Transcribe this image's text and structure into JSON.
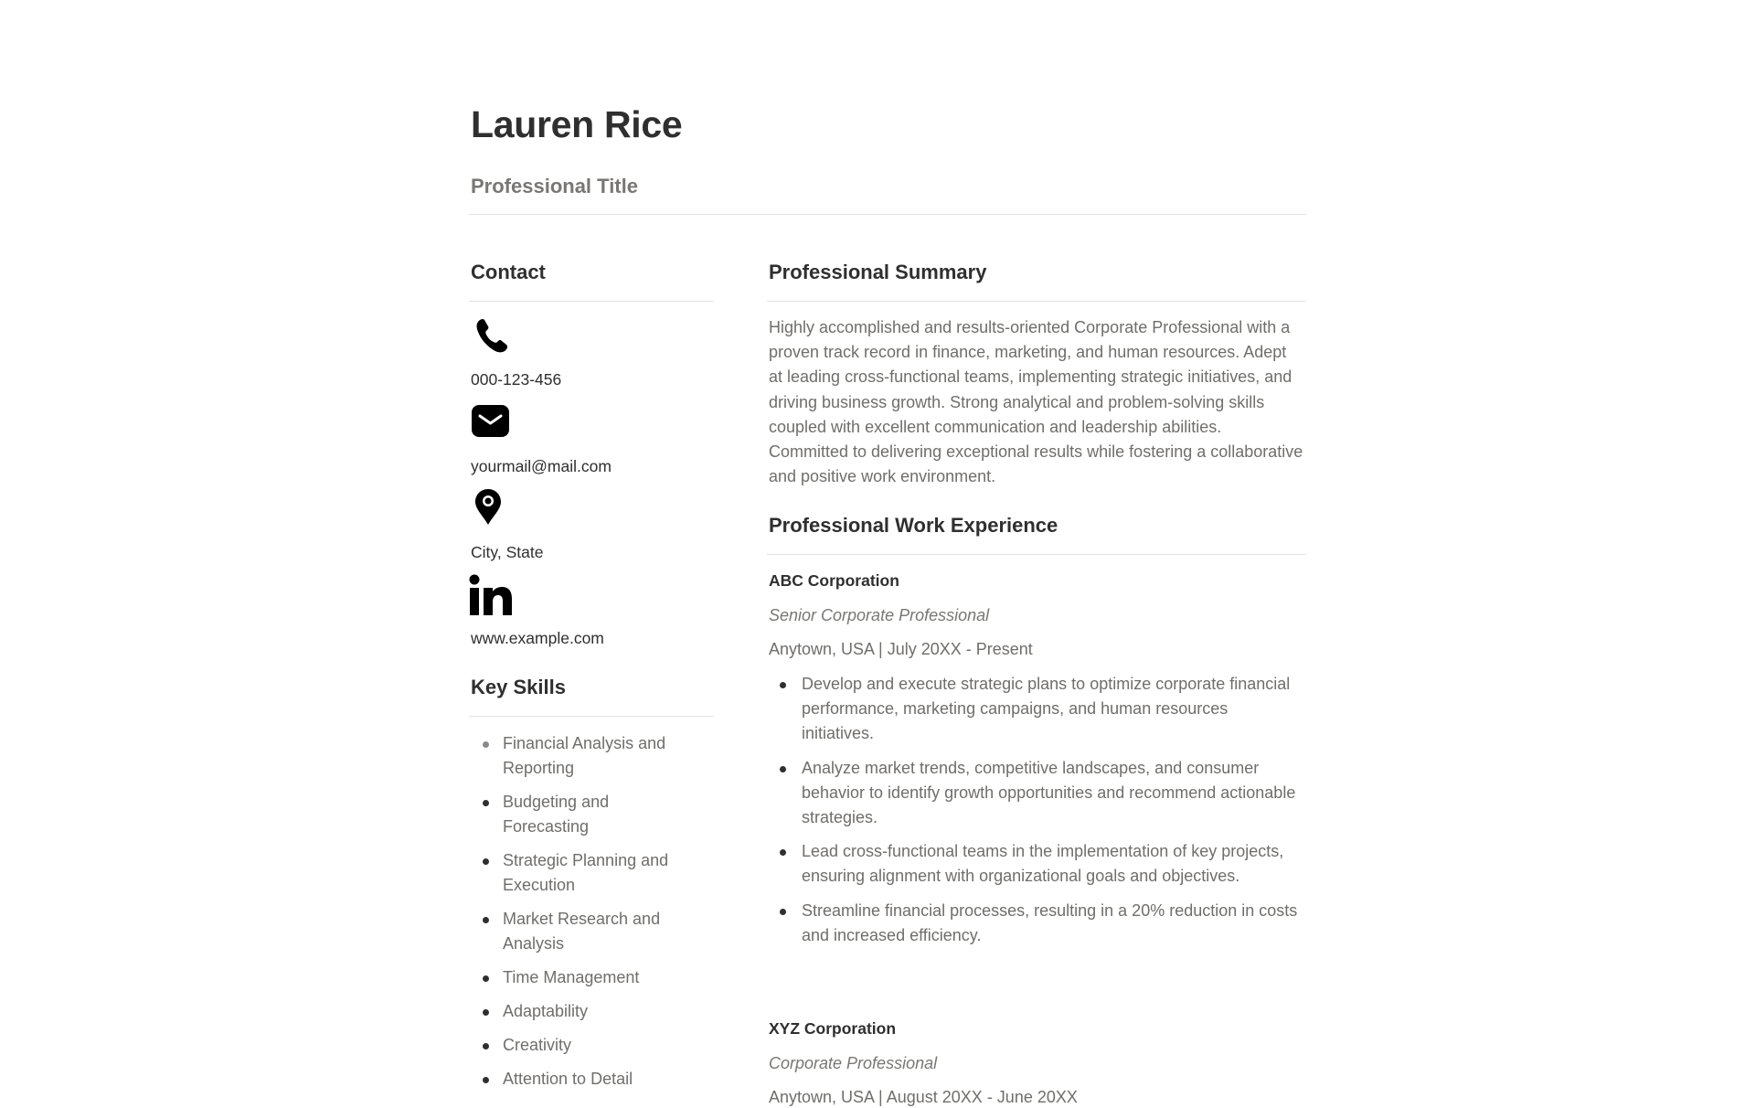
{
  "header": {
    "name": "Lauren Rice",
    "title": "Professional Title"
  },
  "contact": {
    "heading": "Contact",
    "items": [
      {
        "icon": "phone-icon",
        "value": "000-123-456"
      },
      {
        "icon": "email-icon",
        "value": "yourmail@mail.com"
      },
      {
        "icon": "location-pin-icon",
        "value": "City, State"
      },
      {
        "icon": "linkedin-icon",
        "value": "www.example.com"
      }
    ]
  },
  "skills": {
    "heading": "Key Skills",
    "items": [
      "Financial Analysis and Reporting",
      "Budgeting and Forecasting",
      "Strategic Planning and Execution",
      "Market Research and Analysis",
      "Time Management",
      "Adaptability",
      "Creativity",
      "Attention to Detail"
    ]
  },
  "summary": {
    "heading": "Professional Summary",
    "text": "Highly accomplished and results-oriented Corporate Professional with a proven track record in finance, marketing, and human resources. Adept at leading cross-functional teams, implementing strategic initiatives, and driving business growth. Strong analytical and problem-solving skills coupled with excellent communication and leadership abilities. Committed to delivering exceptional results while fostering a collaborative and positive work environment."
  },
  "experience": {
    "heading": "Professional Work Experience",
    "jobs": [
      {
        "company": "ABC Corporation",
        "role": "Senior Corporate Professional",
        "meta": "Anytown, USA | July 20XX - Present",
        "duties": [
          "Develop and execute strategic plans to optimize corporate financial performance, marketing campaigns, and human resources initiatives.",
          "Analyze market trends, competitive landscapes, and consumer behavior to identify growth opportunities and recommend actionable strategies.",
          "Lead cross-functional teams in the implementation of key projects, ensuring alignment with organizational goals and objectives.",
          "Streamline financial processes, resulting in a 20% reduction in costs and increased efficiency."
        ]
      },
      {
        "company": "XYZ Corporation",
        "role": "Corporate Professional",
        "meta": "Anytown, USA | August 20XX - June 20XX",
        "duties": []
      }
    ]
  },
  "colors": {
    "heading": "#2f2f2f",
    "body_text": "#6f6e6b",
    "muted": "#787774",
    "divider": "#e3e2e0"
  }
}
